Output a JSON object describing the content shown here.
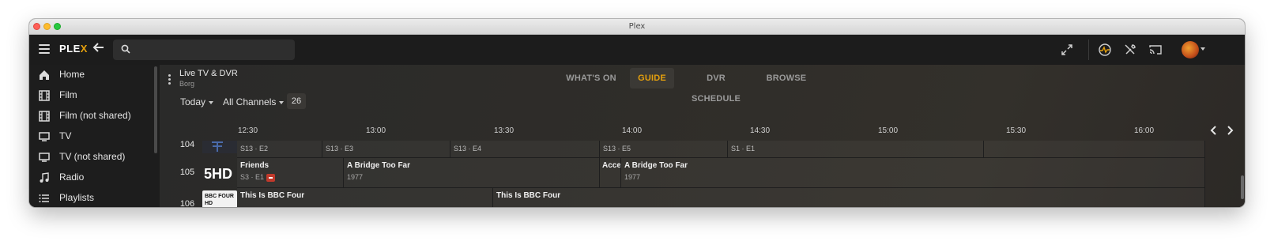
{
  "window": {
    "title": "Plex"
  },
  "topbar": {
    "logo_text": "PLEX",
    "logo_accent": "X",
    "search": {
      "value": "",
      "placeholder": ""
    },
    "icons": [
      "menu-icon",
      "back-arrow-icon",
      "search-icon",
      "fullscreen-icon",
      "activity-icon",
      "settings-icon",
      "cast-icon",
      "avatar"
    ]
  },
  "sidebar": {
    "items": [
      {
        "label": "Home",
        "icon": "home-icon"
      },
      {
        "label": "Film",
        "icon": "film-icon"
      },
      {
        "label": "Film (not shared)",
        "icon": "film-icon"
      },
      {
        "label": "TV",
        "icon": "tv-icon"
      },
      {
        "label": "TV (not shared)",
        "icon": "tv-icon"
      },
      {
        "label": "Radio",
        "icon": "music-note-icon"
      },
      {
        "label": "Playlists",
        "icon": "playlist-icon"
      }
    ]
  },
  "section": {
    "title": "Live TV & DVR",
    "subtitle": "Borg"
  },
  "tabs": [
    {
      "label": "WHAT'S ON",
      "active": false
    },
    {
      "label": "GUIDE",
      "active": true
    },
    {
      "label": "DVR SCHEDULE",
      "active": false
    },
    {
      "label": "BROWSE",
      "active": false
    }
  ],
  "filters": {
    "day": "Today",
    "channels": "All Channels",
    "count": "26"
  },
  "timeline": [
    "12:30",
    "13:00",
    "13:30",
    "14:00",
    "14:30",
    "15:00",
    "15:30",
    "16:00"
  ],
  "guide": {
    "rows": [
      {
        "channel": "104",
        "programs": [
          {
            "title": "",
            "sub": "S13 · E2"
          },
          {
            "title": "",
            "sub": "S13 · E3"
          },
          {
            "title": "",
            "sub": "S13 · E4"
          },
          {
            "title": "",
            "sub": "S13 · E5"
          },
          {
            "title": "",
            "sub": "S1 · E1"
          },
          {
            "title": "",
            "sub": ""
          }
        ]
      },
      {
        "channel": "105",
        "logo_text": "5HD",
        "programs": [
          {
            "title": "Friends",
            "sub": "S3 · E1",
            "recording": true
          },
          {
            "title": "A Bridge Too Far",
            "sub": "1977"
          },
          {
            "title": "Acces",
            "sub": ""
          },
          {
            "title": "A Bridge Too Far",
            "sub": "1977"
          }
        ]
      },
      {
        "channel": "106",
        "logo_text": "BBC FOUR HD",
        "programs": [
          {
            "title": "This Is BBC Four",
            "sub": ""
          },
          {
            "title": "This Is BBC Four",
            "sub": ""
          }
        ]
      }
    ]
  },
  "colors": {
    "accent": "#e5a00d",
    "record": "#c0392b"
  }
}
